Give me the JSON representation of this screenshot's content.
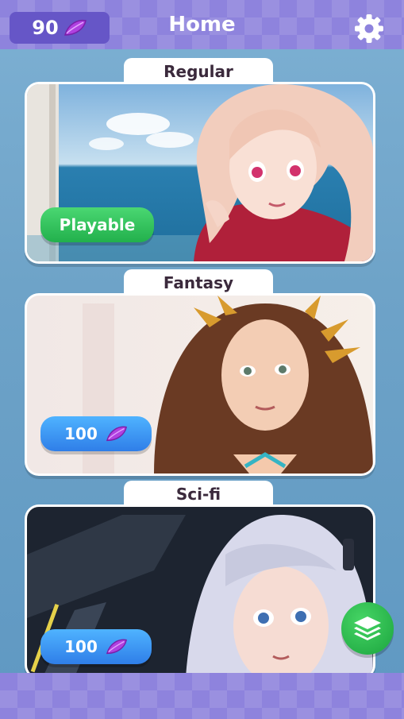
{
  "header": {
    "currency_amount": "90",
    "currency_icon": "purple-petal-icon",
    "title": "Home",
    "settings_icon": "gear-icon"
  },
  "categories": [
    {
      "label": "Regular",
      "button_label": "Playable",
      "button_color": "#2cc155",
      "status": "unlocked"
    },
    {
      "label": "Fantasy",
      "button_label": "100",
      "button_color": "#3a92f2",
      "cost_icon": "purple-petal-icon"
    },
    {
      "label": "Sci-fi",
      "button_label": "100",
      "button_color": "#3a92f2",
      "cost_icon": "purple-petal-icon"
    }
  ],
  "fab_icon": "layers-icon",
  "colors": {
    "header": "#8e83dd",
    "currency_pill": "#6656c7",
    "background": "#6ea3c8",
    "petal": "#a33bd6"
  }
}
